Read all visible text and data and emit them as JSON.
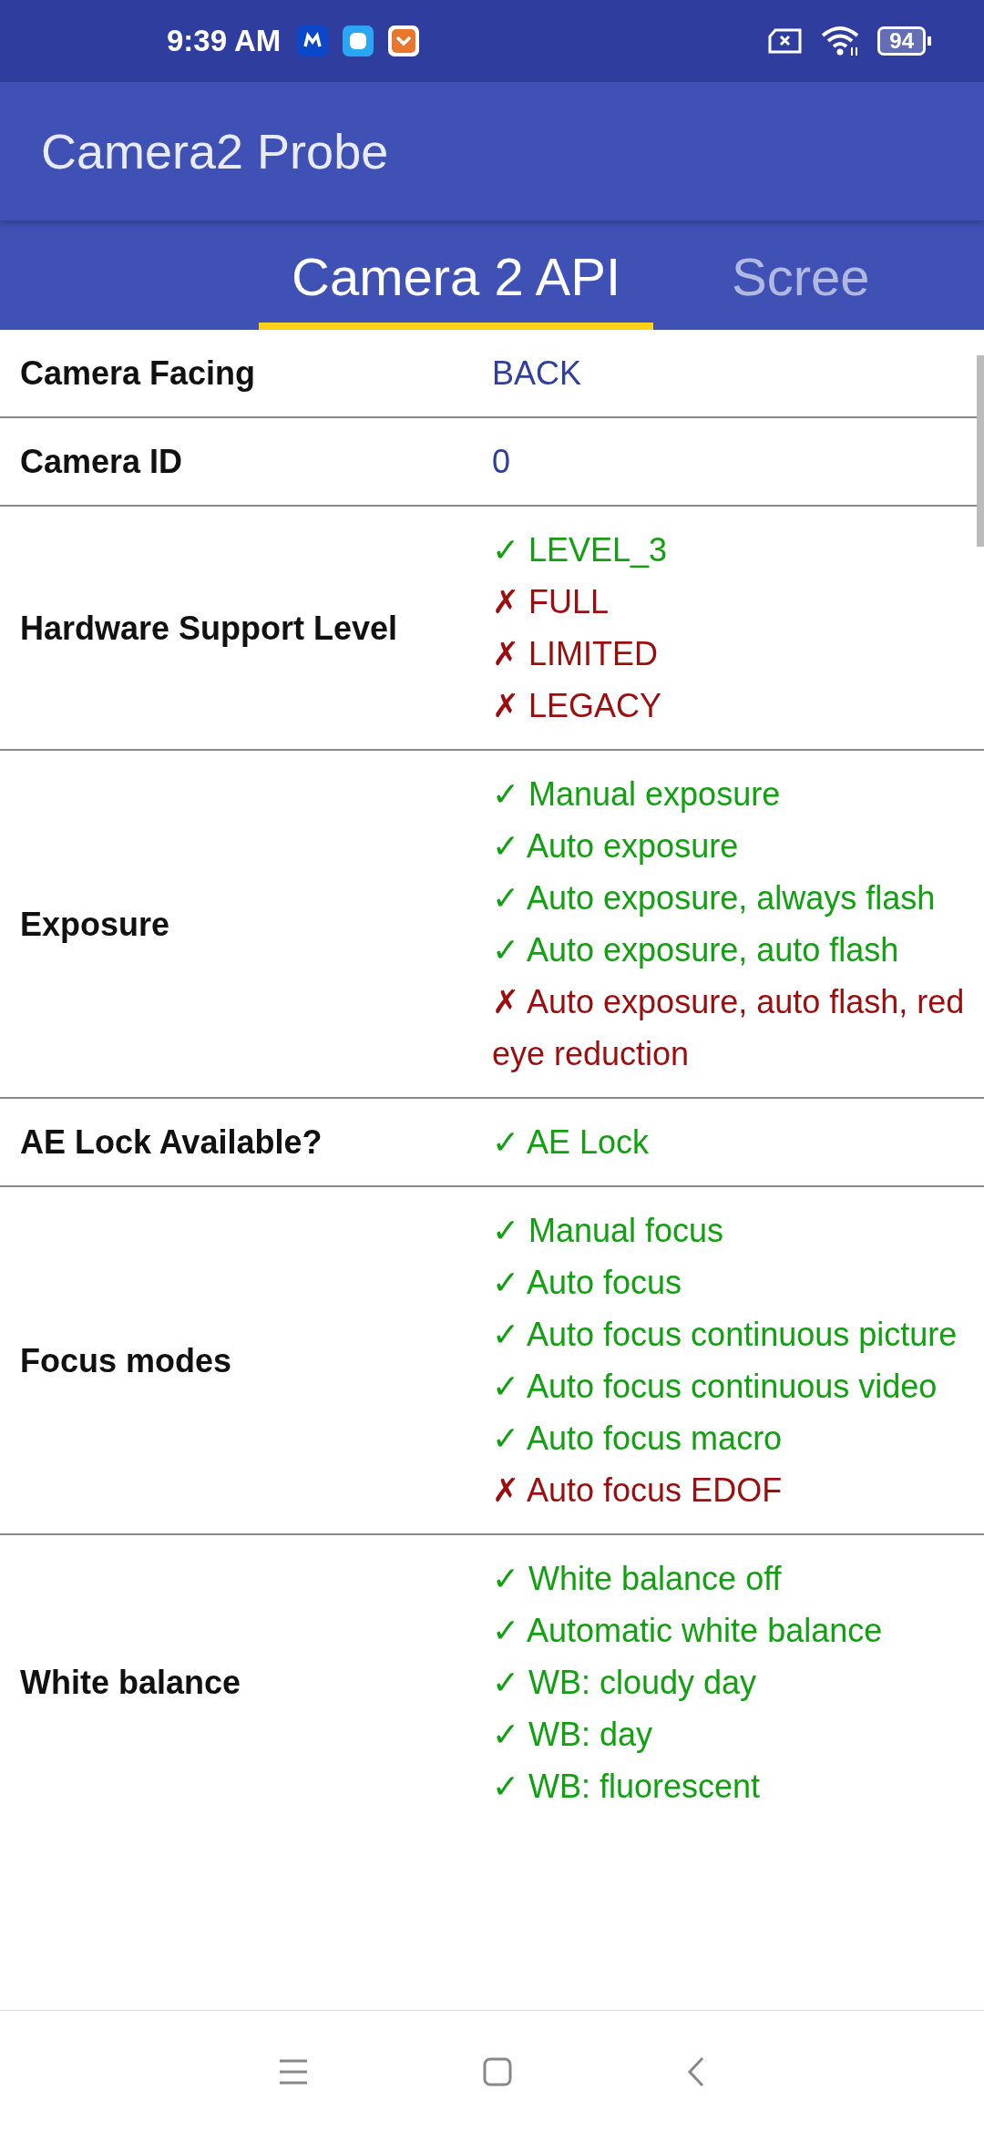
{
  "status_bar": {
    "time": "9:39 AM",
    "battery": "94"
  },
  "app_bar": {
    "title": "Camera2 Probe"
  },
  "tabs": [
    {
      "label": "Camera 2 API",
      "selected": true
    },
    {
      "label": "Scree",
      "selected": false
    }
  ],
  "rows": [
    {
      "label": "Camera Facing",
      "kind": "text",
      "value": "BACK"
    },
    {
      "label": "Camera ID",
      "kind": "text",
      "value": "0"
    },
    {
      "label": "Hardware Support Level",
      "kind": "list",
      "items": [
        {
          "text": "✓ LEVEL_3",
          "supported": true
        },
        {
          "text": "✗ FULL",
          "supported": false
        },
        {
          "text": "✗ LIMITED",
          "supported": false
        },
        {
          "text": "✗ LEGACY",
          "supported": false
        }
      ]
    },
    {
      "label": "Exposure",
      "kind": "list",
      "items": [
        {
          "text": "✓ Manual exposure",
          "supported": true
        },
        {
          "text": "✓ Auto exposure",
          "supported": true
        },
        {
          "text": "✓ Auto exposure, always flash",
          "supported": true
        },
        {
          "text": "✓ Auto exposure, auto flash",
          "supported": true
        },
        {
          "text": "✗ Auto exposure, auto flash, red eye reduction",
          "supported": false
        }
      ]
    },
    {
      "label": "AE Lock Available?",
      "kind": "list",
      "items": [
        {
          "text": "✓ AE Lock",
          "supported": true
        }
      ]
    },
    {
      "label": "Focus modes",
      "kind": "list",
      "items": [
        {
          "text": "✓ Manual focus",
          "supported": true
        },
        {
          "text": "✓ Auto focus",
          "supported": true
        },
        {
          "text": "✓ Auto focus continuous picture",
          "supported": true
        },
        {
          "text": "✓ Auto focus continuous video",
          "supported": true
        },
        {
          "text": "✓ Auto focus macro",
          "supported": true
        },
        {
          "text": "✗ Auto focus EDOF",
          "supported": false
        }
      ]
    },
    {
      "label": "White balance",
      "kind": "list",
      "items": [
        {
          "text": "✓ White balance off",
          "supported": true
        },
        {
          "text": "✓ Automatic white balance",
          "supported": true
        },
        {
          "text": "✓ WB: cloudy day",
          "supported": true
        },
        {
          "text": "✓ WB: day",
          "supported": true
        },
        {
          "text": "✓ WB: fluorescent",
          "supported": true
        }
      ]
    }
  ]
}
